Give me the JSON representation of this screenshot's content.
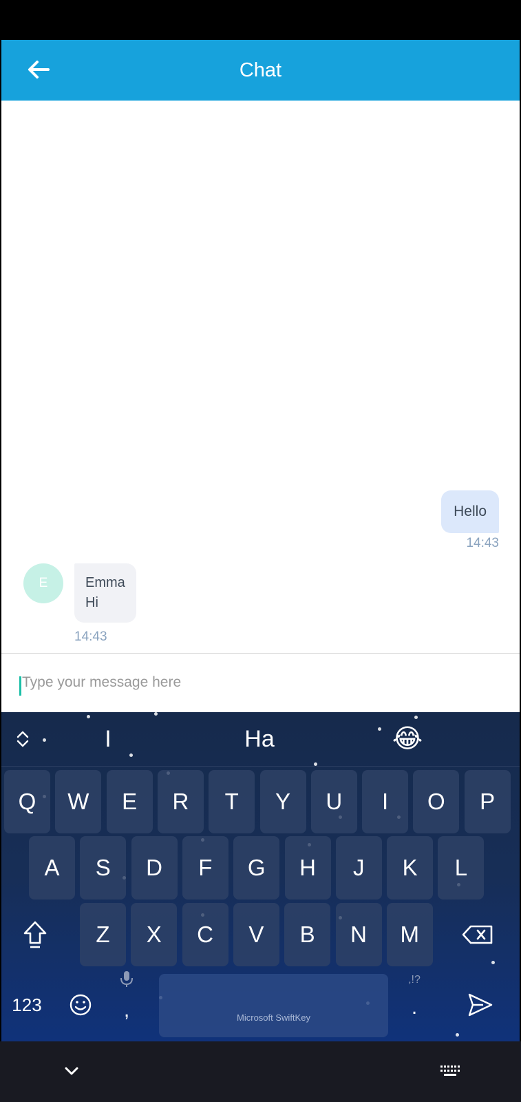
{
  "header": {
    "title": "Chat"
  },
  "messages": {
    "outgoing": {
      "text": "Hello",
      "time": "14:43"
    },
    "incoming": {
      "avatar_initial": "E",
      "sender": "Emma",
      "text": "Hi",
      "time": "14:43"
    }
  },
  "composer": {
    "placeholder": "Type your message here",
    "value": ""
  },
  "keyboard": {
    "suggestions": [
      "I",
      "Ha",
      "😂"
    ],
    "row1": [
      "Q",
      "W",
      "E",
      "R",
      "T",
      "Y",
      "U",
      "I",
      "O",
      "P"
    ],
    "row2": [
      "A",
      "S",
      "D",
      "F",
      "G",
      "H",
      "J",
      "K",
      "L"
    ],
    "row3": [
      "Z",
      "X",
      "C",
      "V",
      "B",
      "N",
      "M"
    ],
    "numbers_label": "123",
    "comma_label": ",",
    "period_label": ".",
    "punct_hint": ",!?",
    "space_label": "Microsoft SwiftKey"
  },
  "colors": {
    "header": "#17a2dc",
    "outgoing_bubble": "#dce8fb",
    "incoming_bubble": "#f1f2f6",
    "avatar": "#c6f1e6",
    "caret": "#1dbfa8"
  },
  "icons": [
    "arrow-left-icon",
    "expand-icon",
    "emoji-face-icon",
    "shift-icon",
    "backspace-icon",
    "mic-icon",
    "send-icon",
    "chevron-down-icon",
    "keyboard-icon"
  ]
}
